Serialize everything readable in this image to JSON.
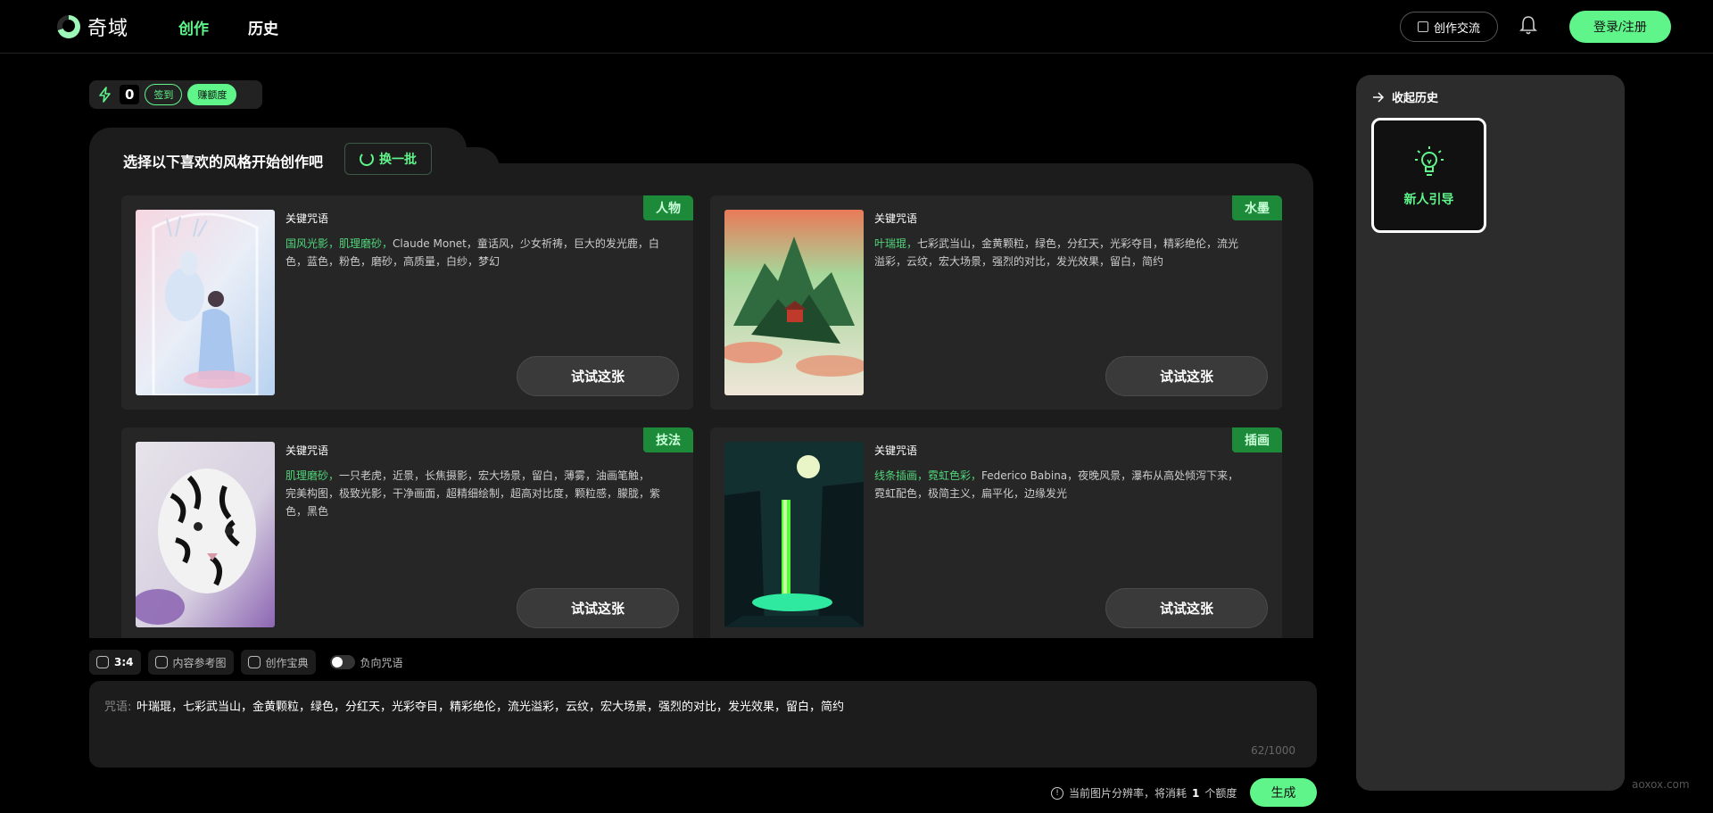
{
  "app": {
    "logo_text": "奇域"
  },
  "nav": {
    "items": [
      {
        "label": "创作",
        "active": true
      },
      {
        "label": "历史",
        "active": false
      }
    ]
  },
  "header": {
    "community_label": "创作交流",
    "login_label": "登录/注册"
  },
  "credits": {
    "count": "0",
    "signin_label": "签到",
    "earn_label": "赚额度"
  },
  "panel": {
    "title": "选择以下喜欢的风格开始创作吧",
    "refresh_label": "换一批"
  },
  "cards": [
    {
      "tag": "人物",
      "keyword_label": "关键咒语",
      "highlight": "国风光影，肌理磨砂，",
      "prompt": "Claude Monet，童话风，少女祈祷，巨大的发光鹿，白色，蓝色，粉色，磨砂，高质量，白纱，梦幻",
      "button": "试试这张"
    },
    {
      "tag": "水墨",
      "keyword_label": "关键咒语",
      "highlight": "叶瑞琨，",
      "prompt": "七彩武当山，金黄颗粒，绿色，分红天，光彩夺目，精彩绝伦，流光溢彩，云纹，宏大场景，强烈的对比，发光效果，留白，简约",
      "button": "试试这张"
    },
    {
      "tag": "技法",
      "keyword_label": "关键咒语",
      "highlight": "肌理磨砂，",
      "prompt": "一只老虎，近景，长焦摄影，宏大场景，留白，薄雾，油画笔触，完美构图，极致光影，干净画面，超精细绘制，超高对比度，颗粒感，朦胧，紫色，黑色",
      "button": "试试这张"
    },
    {
      "tag": "插画",
      "keyword_label": "关键咒语",
      "highlight": "线条插画，霓虹色彩，",
      "prompt": "Federico Babina，夜晚风景，瀑布从高处倾泻下来，霓虹配色，极简主义，扁平化，边缘发光",
      "button": "试试这张"
    }
  ],
  "toolbar": {
    "ratio": "3:4",
    "ref_image": "内容参考图",
    "handbook": "创作宝典",
    "negative": "负向咒语"
  },
  "prompt_box": {
    "label": "咒语:",
    "value": "叶瑞琨，七彩武当山，金黄颗粒，绿色，分红天，光彩夺目，精彩绝伦，流光溢彩，云纹，宏大场景，强烈的对比，发光效果，留白，简约",
    "count": "62/1000"
  },
  "cost": {
    "prefix": "当前图片分辨率，将消耗",
    "num": "1",
    "suffix": "个额度"
  },
  "generate_label": "生成",
  "sidebar": {
    "collapse_label": "收起历史",
    "guide_label": "新人引导"
  },
  "watermark": "aoxox.com",
  "colors": {
    "accent": "#5ff58a",
    "tag_bg": "#1d8a3a",
    "panel_bg": "#1c1c1c",
    "card_bg": "#262626"
  }
}
